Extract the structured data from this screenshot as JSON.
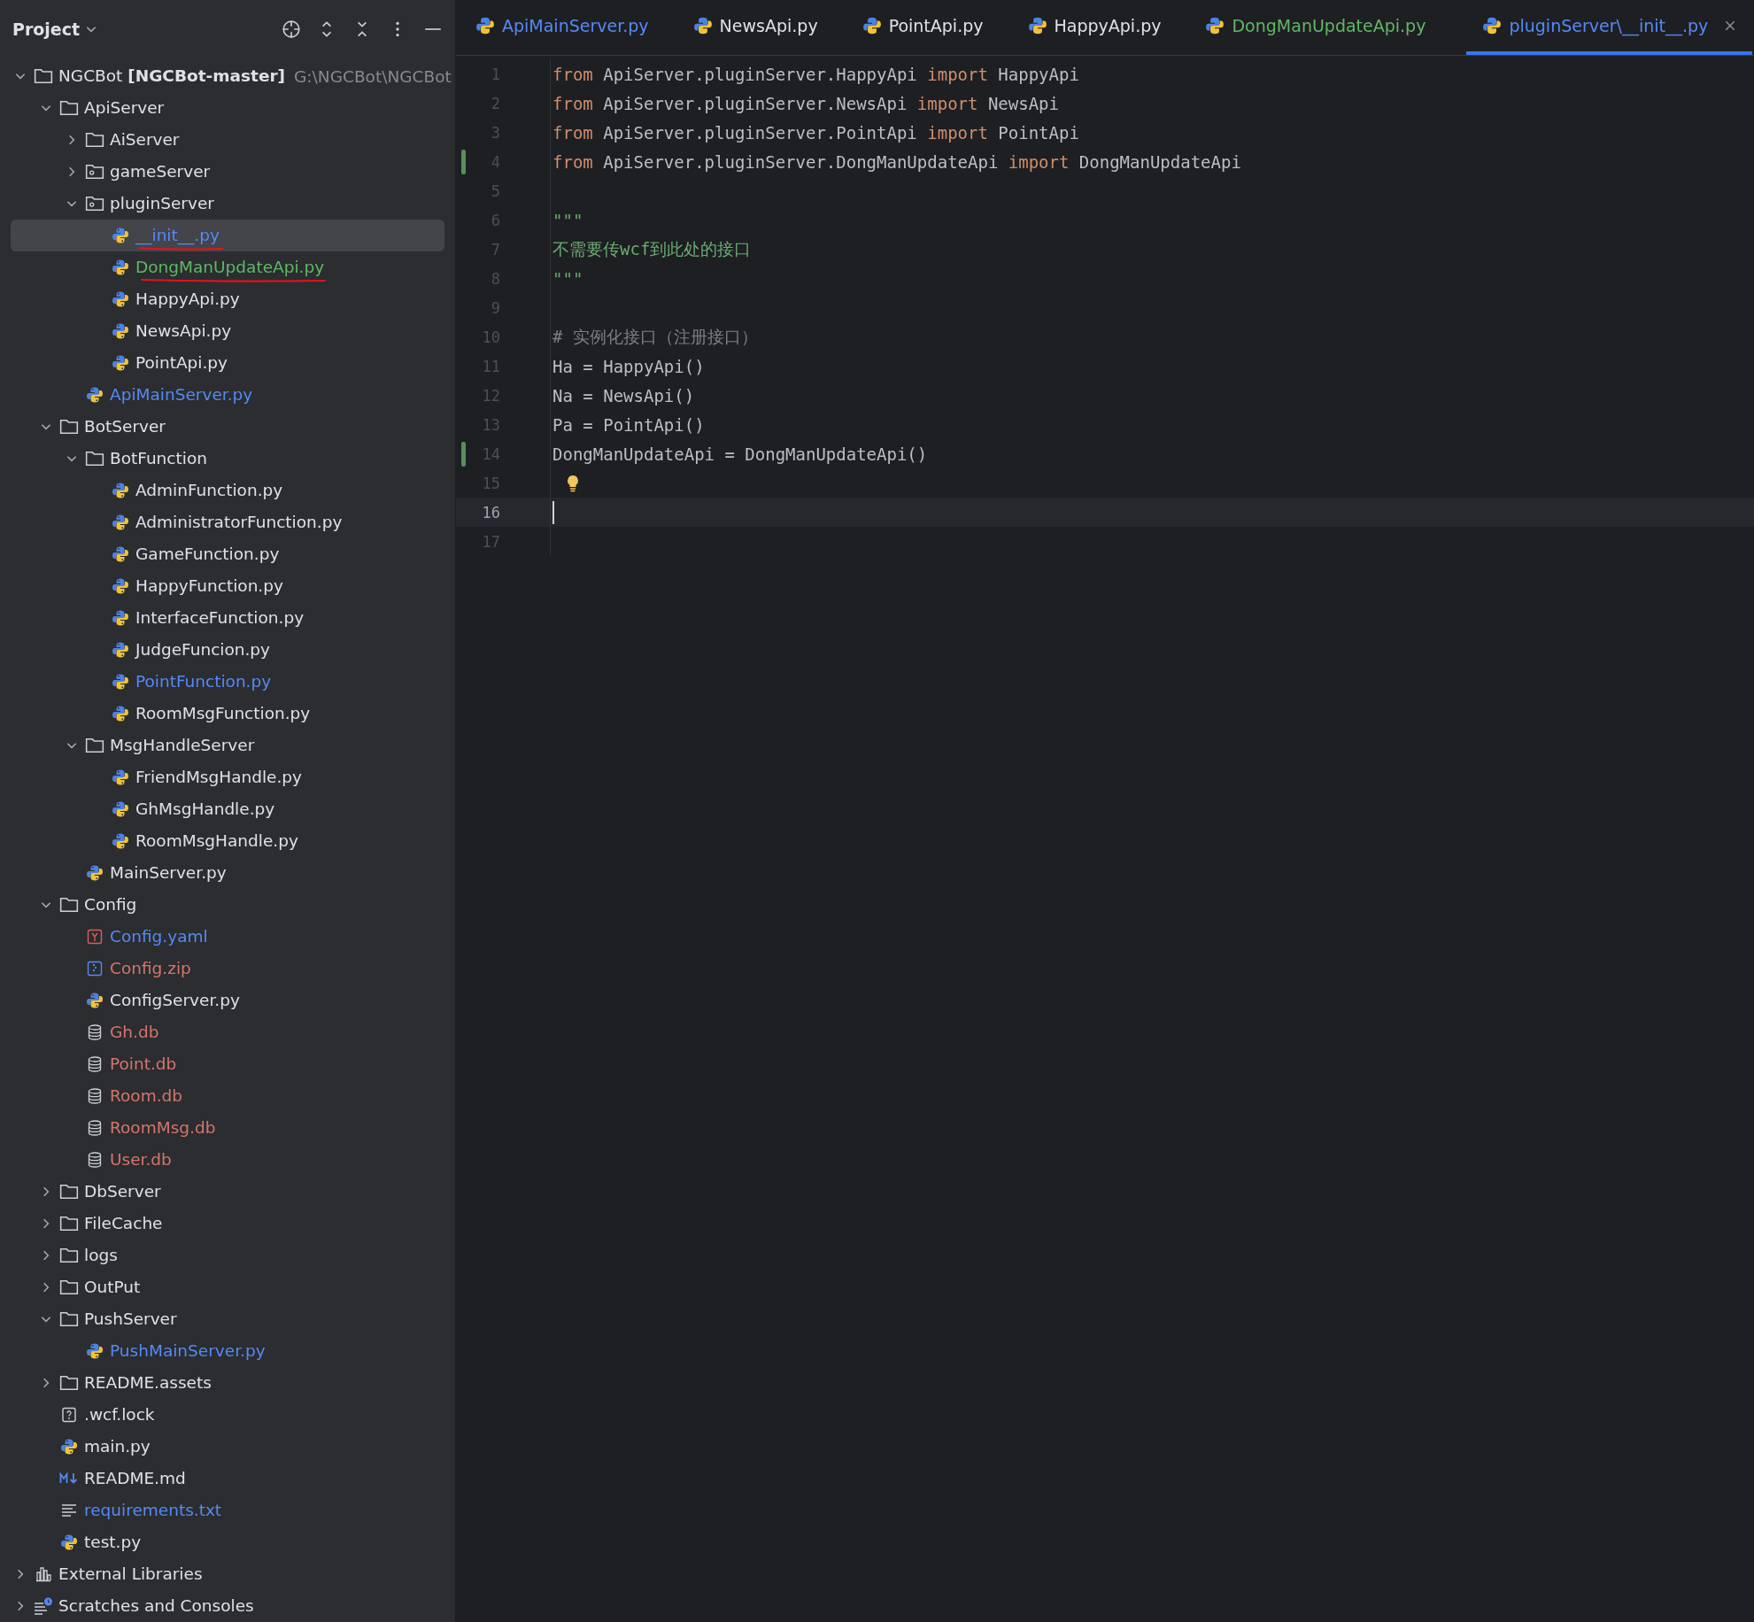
{
  "project_panel": {
    "title": "Project",
    "tree": [
      {
        "kind": "folder",
        "label": "NGCBot **[NGCBot-master]**",
        "path": "G:\\NGCBot\\NGCBot",
        "color": "#dfe1e5",
        "expanded": true,
        "selected": false,
        "children": [
          {
            "kind": "folder",
            "label": "ApiServer",
            "color": "#dfe1e5",
            "expanded": true,
            "selected": false,
            "children": [
              {
                "kind": "folder",
                "label": "AiServer",
                "color": "#dfe1e5",
                "expanded": false,
                "selected": false
              },
              {
                "kind": "package",
                "label": "gameServer",
                "color": "#dfe1e5",
                "expanded": false,
                "selected": false
              },
              {
                "kind": "package",
                "label": "pluginServer",
                "color": "#dfe1e5",
                "expanded": true,
                "selected": false,
                "children": [
                  {
                    "kind": "python",
                    "label": "__init__.py",
                    "color": "#548af7",
                    "selected": true,
                    "underlined": true
                  },
                  {
                    "kind": "python",
                    "label": "DongManUpdateApi.py",
                    "color": "#5fb865",
                    "selected": false,
                    "underlined": true
                  },
                  {
                    "kind": "python",
                    "label": "HappyApi.py",
                    "color": "#dfe1e5",
                    "selected": false
                  },
                  {
                    "kind": "python",
                    "label": "NewsApi.py",
                    "color": "#dfe1e5",
                    "selected": false
                  },
                  {
                    "kind": "python",
                    "label": "PointApi.py",
                    "color": "#dfe1e5",
                    "selected": false
                  }
                ]
              },
              {
                "kind": "python",
                "label": "ApiMainServer.py",
                "color": "#548af7",
                "selected": false
              }
            ]
          },
          {
            "kind": "folder",
            "label": "BotServer",
            "color": "#dfe1e5",
            "expanded": true,
            "selected": false,
            "children": [
              {
                "kind": "folder",
                "label": "BotFunction",
                "color": "#dfe1e5",
                "expanded": true,
                "selected": false,
                "children": [
                  {
                    "kind": "python",
                    "label": "AdminFunction.py",
                    "color": "#dfe1e5",
                    "selected": false
                  },
                  {
                    "kind": "python",
                    "label": "AdministratorFunction.py",
                    "color": "#dfe1e5",
                    "selected": false
                  },
                  {
                    "kind": "python",
                    "label": "GameFunction.py",
                    "color": "#dfe1e5",
                    "selected": false
                  },
                  {
                    "kind": "python",
                    "label": "HappyFunction.py",
                    "color": "#dfe1e5",
                    "selected": false
                  },
                  {
                    "kind": "python",
                    "label": "InterfaceFunction.py",
                    "color": "#dfe1e5",
                    "selected": false
                  },
                  {
                    "kind": "python",
                    "label": "JudgeFuncion.py",
                    "color": "#dfe1e5",
                    "selected": false
                  },
                  {
                    "kind": "python",
                    "label": "PointFunction.py",
                    "color": "#548af7",
                    "selected": false
                  },
                  {
                    "kind": "python",
                    "label": "RoomMsgFunction.py",
                    "color": "#dfe1e5",
                    "selected": false
                  }
                ]
              },
              {
                "kind": "folder",
                "label": "MsgHandleServer",
                "color": "#dfe1e5",
                "expanded": true,
                "selected": false,
                "children": [
                  {
                    "kind": "python",
                    "label": "FriendMsgHandle.py",
                    "color": "#dfe1e5",
                    "selected": false
                  },
                  {
                    "kind": "python",
                    "label": "GhMsgHandle.py",
                    "color": "#dfe1e5",
                    "selected": false
                  },
                  {
                    "kind": "python",
                    "label": "RoomMsgHandle.py",
                    "color": "#dfe1e5",
                    "selected": false
                  }
                ]
              },
              {
                "kind": "python",
                "label": "MainServer.py",
                "color": "#dfe1e5",
                "selected": false
              }
            ]
          },
          {
            "kind": "folder",
            "label": "Config",
            "color": "#dfe1e5",
            "expanded": true,
            "selected": false,
            "children": [
              {
                "kind": "yaml",
                "label": "Config.yaml",
                "color": "#548af7",
                "selected": false
              },
              {
                "kind": "zip",
                "label": "Config.zip",
                "color": "#d5756c",
                "selected": false
              },
              {
                "kind": "python",
                "label": "ConfigServer.py",
                "color": "#dfe1e5",
                "selected": false
              },
              {
                "kind": "database",
                "label": "Gh.db",
                "color": "#d5756c",
                "selected": false
              },
              {
                "kind": "database",
                "label": "Point.db",
                "color": "#d5756c",
                "selected": false
              },
              {
                "kind": "database",
                "label": "Room.db",
                "color": "#d5756c",
                "selected": false
              },
              {
                "kind": "database",
                "label": "RoomMsg.db",
                "color": "#d5756c",
                "selected": false
              },
              {
                "kind": "database",
                "label": "User.db",
                "color": "#d5756c",
                "selected": false
              }
            ]
          },
          {
            "kind": "folder",
            "label": "DbServer",
            "color": "#dfe1e5",
            "expanded": false,
            "selected": false
          },
          {
            "kind": "folder",
            "label": "FileCache",
            "color": "#dfe1e5",
            "expanded": false,
            "selected": false
          },
          {
            "kind": "folder",
            "label": "logs",
            "color": "#dfe1e5",
            "expanded": false,
            "selected": false
          },
          {
            "kind": "folder",
            "label": "OutPut",
            "color": "#dfe1e5",
            "expanded": false,
            "selected": false
          },
          {
            "kind": "folder",
            "label": "PushServer",
            "color": "#dfe1e5",
            "expanded": true,
            "selected": false,
            "children": [
              {
                "kind": "python",
                "label": "PushMainServer.py",
                "color": "#548af7",
                "selected": false
              }
            ]
          },
          {
            "kind": "folder",
            "label": "README.assets",
            "color": "#dfe1e5",
            "expanded": false,
            "selected": false
          },
          {
            "kind": "unknown",
            "label": ".wcf.lock",
            "color": "#dfe1e5",
            "selected": false
          },
          {
            "kind": "python",
            "label": "main.py",
            "color": "#dfe1e5",
            "selected": false
          },
          {
            "kind": "markdown",
            "label": "README.md",
            "color": "#dfe1e5",
            "selected": false
          },
          {
            "kind": "text",
            "label": "requirements.txt",
            "color": "#548af7",
            "selected": false
          },
          {
            "kind": "python",
            "label": "test.py",
            "color": "#dfe1e5",
            "selected": false
          }
        ]
      },
      {
        "kind": "libraries",
        "label": "External Libraries",
        "color": "#dfe1e5",
        "expanded": false,
        "selected": false
      },
      {
        "kind": "scratches",
        "label": "Scratches and Consoles",
        "color": "#dfe1e5",
        "expanded": false,
        "selected": false
      }
    ]
  },
  "editor": {
    "tabs": [
      {
        "label": "ApiMainServer.py",
        "color": "#548af7",
        "selected": false
      },
      {
        "label": "NewsApi.py",
        "color": "#dfe1e5",
        "selected": false
      },
      {
        "label": "PointApi.py",
        "color": "#dfe1e5",
        "selected": false
      },
      {
        "label": "HappyApi.py",
        "color": "#dfe1e5",
        "selected": false
      },
      {
        "label": "DongManUpdateApi.py",
        "color": "#5fb865",
        "selected": false
      },
      {
        "label": "pluginServer\\__init__.py",
        "color": "#548af7",
        "selected": true
      }
    ],
    "lines": [
      {
        "number": "1",
        "changed": false,
        "current": false,
        "hint": false,
        "tokens": [
          {
            "kind": "keyword",
            "text": "from"
          },
          {
            "kind": "plain",
            "text": " ApiServer.pluginServer.HappyApi "
          },
          {
            "kind": "keyword",
            "text": "import"
          },
          {
            "kind": "plain",
            "text": " HappyApi"
          }
        ]
      },
      {
        "number": "2",
        "changed": false,
        "current": false,
        "hint": false,
        "tokens": [
          {
            "kind": "keyword",
            "text": "from"
          },
          {
            "kind": "plain",
            "text": " ApiServer.pluginServer.NewsApi "
          },
          {
            "kind": "keyword",
            "text": "import"
          },
          {
            "kind": "plain",
            "text": " NewsApi"
          }
        ]
      },
      {
        "number": "3",
        "changed": false,
        "current": false,
        "hint": false,
        "tokens": [
          {
            "kind": "keyword",
            "text": "from"
          },
          {
            "kind": "plain",
            "text": " ApiServer.pluginServer.PointApi "
          },
          {
            "kind": "keyword",
            "text": "import"
          },
          {
            "kind": "plain",
            "text": " PointApi"
          }
        ]
      },
      {
        "number": "4",
        "changed": true,
        "current": false,
        "hint": false,
        "tokens": [
          {
            "kind": "keyword",
            "text": "from"
          },
          {
            "kind": "plain",
            "text": " ApiServer.pluginServer.DongManUpdateApi "
          },
          {
            "kind": "keyword",
            "text": "import"
          },
          {
            "kind": "plain",
            "text": " DongManUpdateApi"
          }
        ]
      },
      {
        "number": "5",
        "changed": false,
        "current": false,
        "hint": false
      },
      {
        "number": "6",
        "changed": false,
        "current": false,
        "hint": false,
        "tokens": [
          {
            "kind": "string",
            "text": "\"\"\""
          }
        ]
      },
      {
        "number": "7",
        "changed": false,
        "current": false,
        "hint": false,
        "tokens": [
          {
            "kind": "string",
            "text": "不需要传wcf到此处的接口"
          }
        ]
      },
      {
        "number": "8",
        "changed": false,
        "current": false,
        "hint": false,
        "tokens": [
          {
            "kind": "string",
            "text": "\"\"\""
          }
        ]
      },
      {
        "number": "9",
        "changed": false,
        "current": false,
        "hint": false
      },
      {
        "number": "10",
        "changed": false,
        "current": false,
        "hint": false,
        "tokens": [
          {
            "kind": "comment",
            "text": "# 实例化接口（注册接口）"
          }
        ]
      },
      {
        "number": "11",
        "changed": false,
        "current": false,
        "hint": false,
        "tokens": [
          {
            "kind": "plain",
            "text": "Ha = HappyApi()"
          }
        ]
      },
      {
        "number": "12",
        "changed": false,
        "current": false,
        "hint": false,
        "tokens": [
          {
            "kind": "plain",
            "text": "Na = NewsApi()"
          }
        ]
      },
      {
        "number": "13",
        "changed": false,
        "current": false,
        "hint": false,
        "tokens": [
          {
            "kind": "plain",
            "text": "Pa = PointApi()"
          }
        ]
      },
      {
        "number": "14",
        "changed": true,
        "current": false,
        "hint": false,
        "tokens": [
          {
            "kind": "plain",
            "text": "DongManUpdateApi = DongManUpdateApi()"
          }
        ]
      },
      {
        "number": "15",
        "changed": false,
        "current": false,
        "hint": true
      },
      {
        "number": "16",
        "changed": false,
        "current": true,
        "hint": false
      },
      {
        "number": "17",
        "changed": false,
        "current": false,
        "hint": false
      }
    ]
  }
}
